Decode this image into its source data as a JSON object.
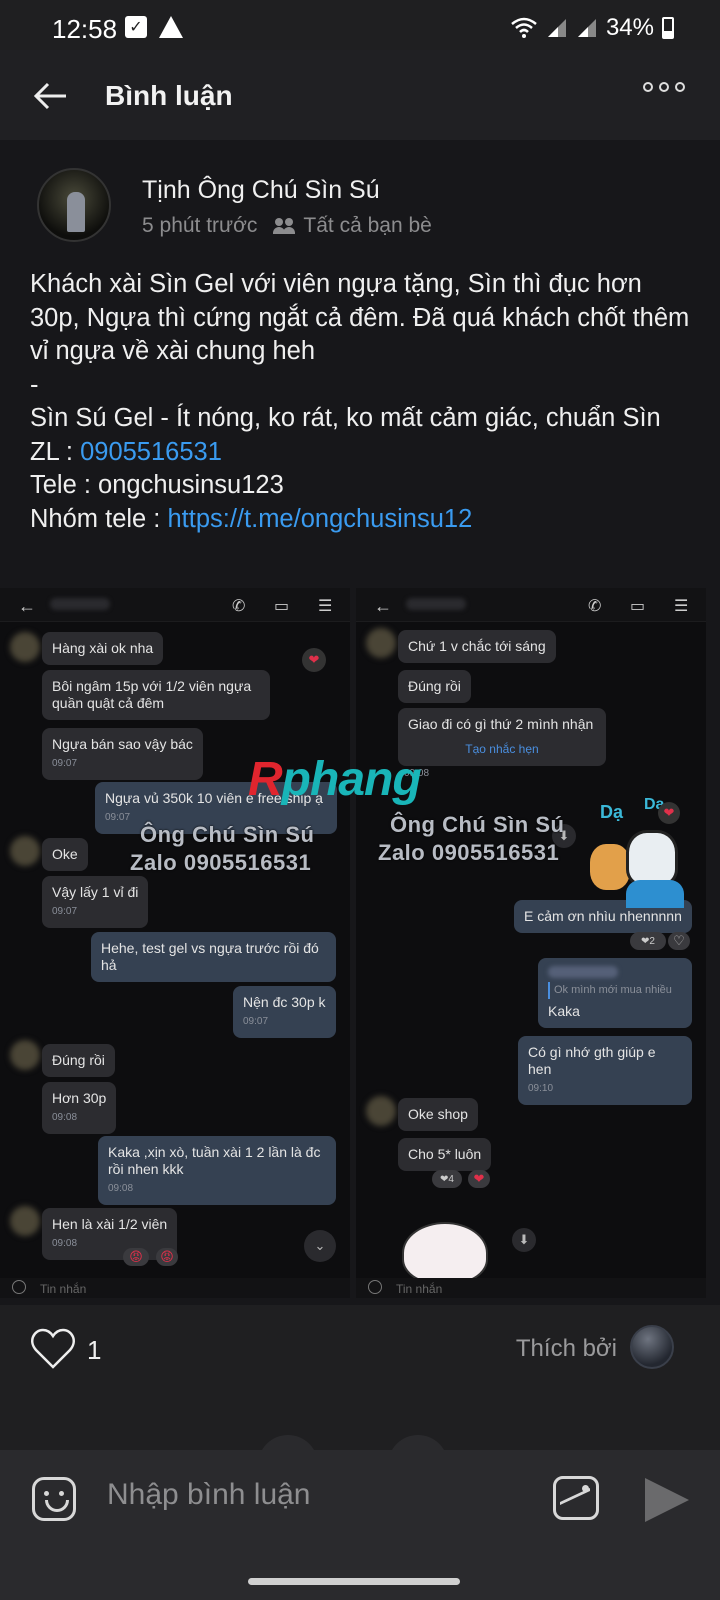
{
  "status": {
    "time": "12:58",
    "battery": "34%"
  },
  "header": {
    "title": "Bình luận"
  },
  "post": {
    "author": "Tịnh Ông Chú Sìn Sú",
    "time_ago": "5 phút trước",
    "audience": "Tất cả bạn bè",
    "lines": [
      "Khách xài Sìn Gel với viên ngựa tặng, Sìn thì đục hơn 30p, Ngựa thì cứng ngắt cả đêm. Đã quá khách chốt thêm vỉ ngựa về xài chung heh",
      "-",
      "Sìn Sú Gel - Ít nóng, ko rát, ko mất cảm giác, chuẩn Sìn"
    ],
    "zl_label": "ZL : ",
    "zl_value": "0905516531",
    "tele_line": "Tele : ongchusinsu123",
    "group_label": "Nhóm tele : ",
    "group_link": "https://t.me/ongchusinsu12"
  },
  "screenshot_left": {
    "messages": [
      {
        "text": "Hàng xài ok nha",
        "time": ""
      },
      {
        "text": "Bôi ngâm 15p với 1/2 viên ngựa quần quật cả đêm",
        "time": ""
      },
      {
        "text": "Ngựa bán sao vậy bác",
        "time": "09:07"
      },
      {
        "text": "Ngựa vủ 350k 10 viên e free ship ạ",
        "time": "09:07"
      },
      {
        "text": "Oke",
        "time": ""
      },
      {
        "text": "Vậy lấy 1 vỉ đi",
        "time": "09:07"
      },
      {
        "text": "Hehe, test gel vs ngựa trước rồi đó hả",
        "time": ""
      },
      {
        "text": "Nện đc 30p k",
        "time": "09:07"
      },
      {
        "text": "Đúng rồi",
        "time": ""
      },
      {
        "text": "Hơn 30p",
        "time": "09:08"
      },
      {
        "text": "Kaka ,xịn xò, tuần xài 1 2 lần là đc rồi nhen kkk",
        "time": "09:08"
      },
      {
        "text": "Hen là xài 1/2 viên",
        "time": "09:08"
      }
    ],
    "input_placeholder": "Tin nhắn"
  },
  "screenshot_right": {
    "messages": [
      {
        "text": "Chứ 1 v chắc tới sáng",
        "time": ""
      },
      {
        "text": "Đúng rồi",
        "time": ""
      },
      {
        "text": "Giao đi có gì thứ 2 mình nhận",
        "time": ""
      },
      {
        "text": "Tạo nhắc hẹn",
        "time": "09:08"
      },
      {
        "text": "E cảm ơn nhìu nhennnnn",
        "time": ""
      },
      {
        "text": "Ok mình mới mua nhiều",
        "time": ""
      },
      {
        "text": "Kaka",
        "time": ""
      },
      {
        "text": "Có gì nhớ gth giúp e hen",
        "time": "09:10"
      },
      {
        "text": "Oke shop",
        "time": ""
      },
      {
        "text": "Cho 5* luôn",
        "time": ""
      }
    ],
    "reaction_count_a": "2",
    "reaction_count_b": "4",
    "sticker_text_1": "Dạ",
    "sticker_text_2": "Dạ",
    "input_placeholder": "Tin nhắn"
  },
  "watermark": {
    "logo_r": "R",
    "logo_rest": "phang",
    "line1": "Ông Chú Sìn Sú",
    "line2": "Zalo 0905516531"
  },
  "likes": {
    "count": "1",
    "liked_by": "Thích bởi"
  },
  "comment": {
    "placeholder": "Nhập bình luận"
  },
  "colors": {
    "link": "#3a9bf0",
    "background": "#17171a",
    "bubble_me": "#354152"
  }
}
